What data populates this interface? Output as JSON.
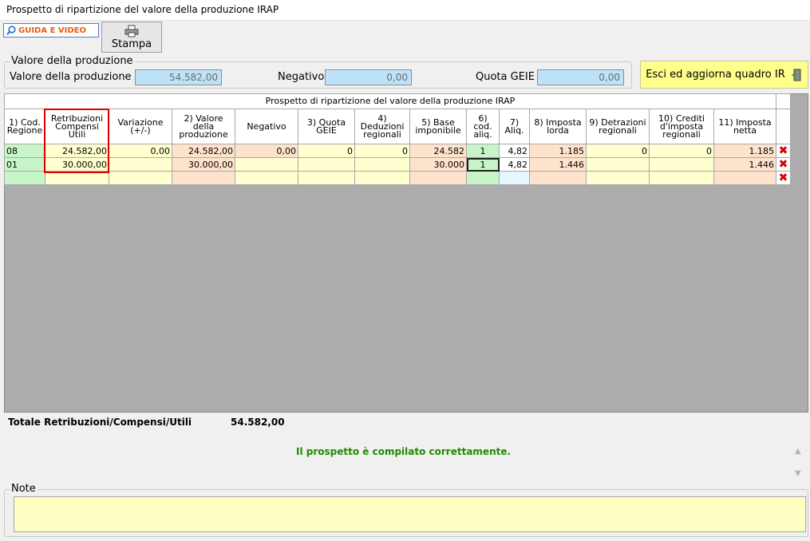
{
  "window": {
    "title": "Prospetto di ripartizione del valore della produzione IRAP"
  },
  "toolbar": {
    "guida_label": "GUIDA E VIDEO",
    "stampa_label": "Stampa",
    "esci_label": "Esci ed aggiorna quadro IR"
  },
  "summary": {
    "group_label": "Valore della produzione",
    "valore_label": "Valore della produzione",
    "valore_value": "54.582,00",
    "negativo_label": "Negativo",
    "negativo_value": "0,00",
    "quota_label": "Quota GEIE",
    "quota_value": "0,00"
  },
  "grid": {
    "title": "Prospetto di ripartizione del valore della produzione IRAP",
    "columns": [
      "1) Cod. Regione",
      "Retribuzioni Compensi Utili",
      "Variazione (+/-)",
      "2) Valore della produzione",
      "Negativo",
      "3) Quota GEIE",
      "4) Deduzioni regionali",
      "5) Base imponibile",
      "6) cod. aliq.",
      "7) Aliq.",
      "8) Imposta lorda",
      "9) Detrazioni regionali",
      "10) Crediti d'imposta regionali",
      "11) Imposta netta"
    ],
    "rows": [
      [
        "08",
        "24.582,00",
        "0,00",
        "24.582,00",
        "0,00",
        "0",
        "0",
        "24.582",
        "1",
        "4,82",
        "1.185",
        "0",
        "0",
        "1.185"
      ],
      [
        "01",
        "30.000,00",
        "",
        "30.000,00",
        "",
        "",
        "",
        "30.000",
        "1",
        "4,82",
        "1.446",
        "",
        "",
        "1.446"
      ],
      [
        "",
        "",
        "",
        "",
        "",
        "",
        "",
        "",
        "",
        "",
        "",
        "",
        "",
        ""
      ]
    ],
    "delete_glyph": "✖"
  },
  "totale": {
    "label": "Totale Retribuzioni/Compensi/Utili",
    "value": "54.582,00"
  },
  "status_message": "Il prospetto è compilato correttamente.",
  "note": {
    "label": "Note",
    "value": ""
  },
  "colors": {
    "highlight_red": "#e00000",
    "success_green": "#1f8a00",
    "button_yellow": "#ffff8c"
  }
}
